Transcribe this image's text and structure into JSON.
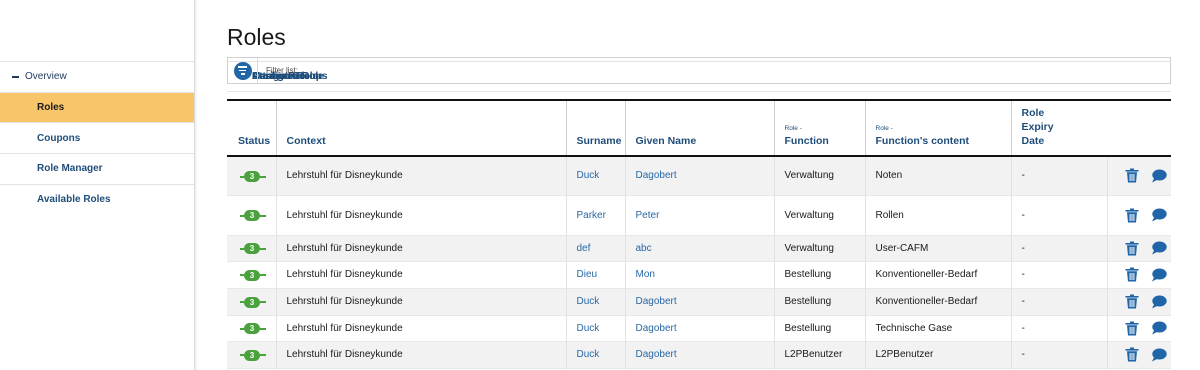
{
  "sidebar": {
    "items": [
      {
        "label": "Overview"
      },
      {
        "label": "Roles"
      },
      {
        "label": "Coupons"
      },
      {
        "label": "Role Manager"
      },
      {
        "label": "Available Roles"
      },
      {
        "label": "Assign Role"
      },
      {
        "label": "Attribute Role"
      },
      {
        "label": "Configure Role"
      },
      {
        "label": "Manage Groups"
      }
    ]
  },
  "page": {
    "title": "Roles",
    "filter_placeholder": "Filter list:"
  },
  "table": {
    "headers": {
      "status": "Status",
      "context": "Context",
      "surname": "Surname",
      "given_name": "Given Name",
      "function_prefix": "Role -",
      "function": "Function",
      "content_prefix": "Role -",
      "content": "Function's content",
      "expiry_1": "Role",
      "expiry_2": "Expiry",
      "expiry_3": "Date"
    },
    "rows": [
      {
        "status": "3",
        "context": "Lehrstuhl für Disneykunde",
        "surname": "Duck",
        "given": "Dagobert",
        "function": "Verwaltung",
        "content": "Noten",
        "expiry": "-"
      },
      {
        "status": "3",
        "context": "Lehrstuhl für Disneykunde",
        "surname": "Parker",
        "given": "Peter",
        "function": "Verwaltung",
        "content": "Rollen",
        "expiry": "-"
      },
      {
        "status": "3",
        "context": "Lehrstuhl für Disneykunde",
        "surname": "def",
        "given": "abc",
        "function": "Verwaltung",
        "content": "User-CAFM",
        "expiry": "-"
      },
      {
        "status": "3",
        "context": "Lehrstuhl für Disneykunde",
        "surname": "Dieu",
        "given": "Mon",
        "function": "Bestellung",
        "content": "Konventioneller-Bedarf",
        "expiry": "-"
      },
      {
        "status": "3",
        "context": "Lehrstuhl für Disneykunde",
        "surname": "Duck",
        "given": "Dagobert",
        "function": "Bestellung",
        "content": "Konventioneller-Bedarf",
        "expiry": "-"
      },
      {
        "status": "3",
        "context": "Lehrstuhl für Disneykunde",
        "surname": "Duck",
        "given": "Dagobert",
        "function": "Bestellung",
        "content": "Technische Gase",
        "expiry": "-"
      },
      {
        "status": "3",
        "context": "Lehrstuhl für Disneykunde",
        "surname": "Duck",
        "given": "Dagobert",
        "function": "L2PBenutzer",
        "content": "L2PBenutzer",
        "expiry": "-"
      }
    ]
  },
  "colors": {
    "accent": "#1f65a8",
    "active_nav": "#f8c56a",
    "status_green": "#49a23c",
    "link": "#2868a6"
  },
  "icons": {
    "filter": "filter-lines-icon",
    "delete": "trash-icon",
    "comment": "speech-bubble-icon",
    "status": "plug-badge-icon"
  }
}
